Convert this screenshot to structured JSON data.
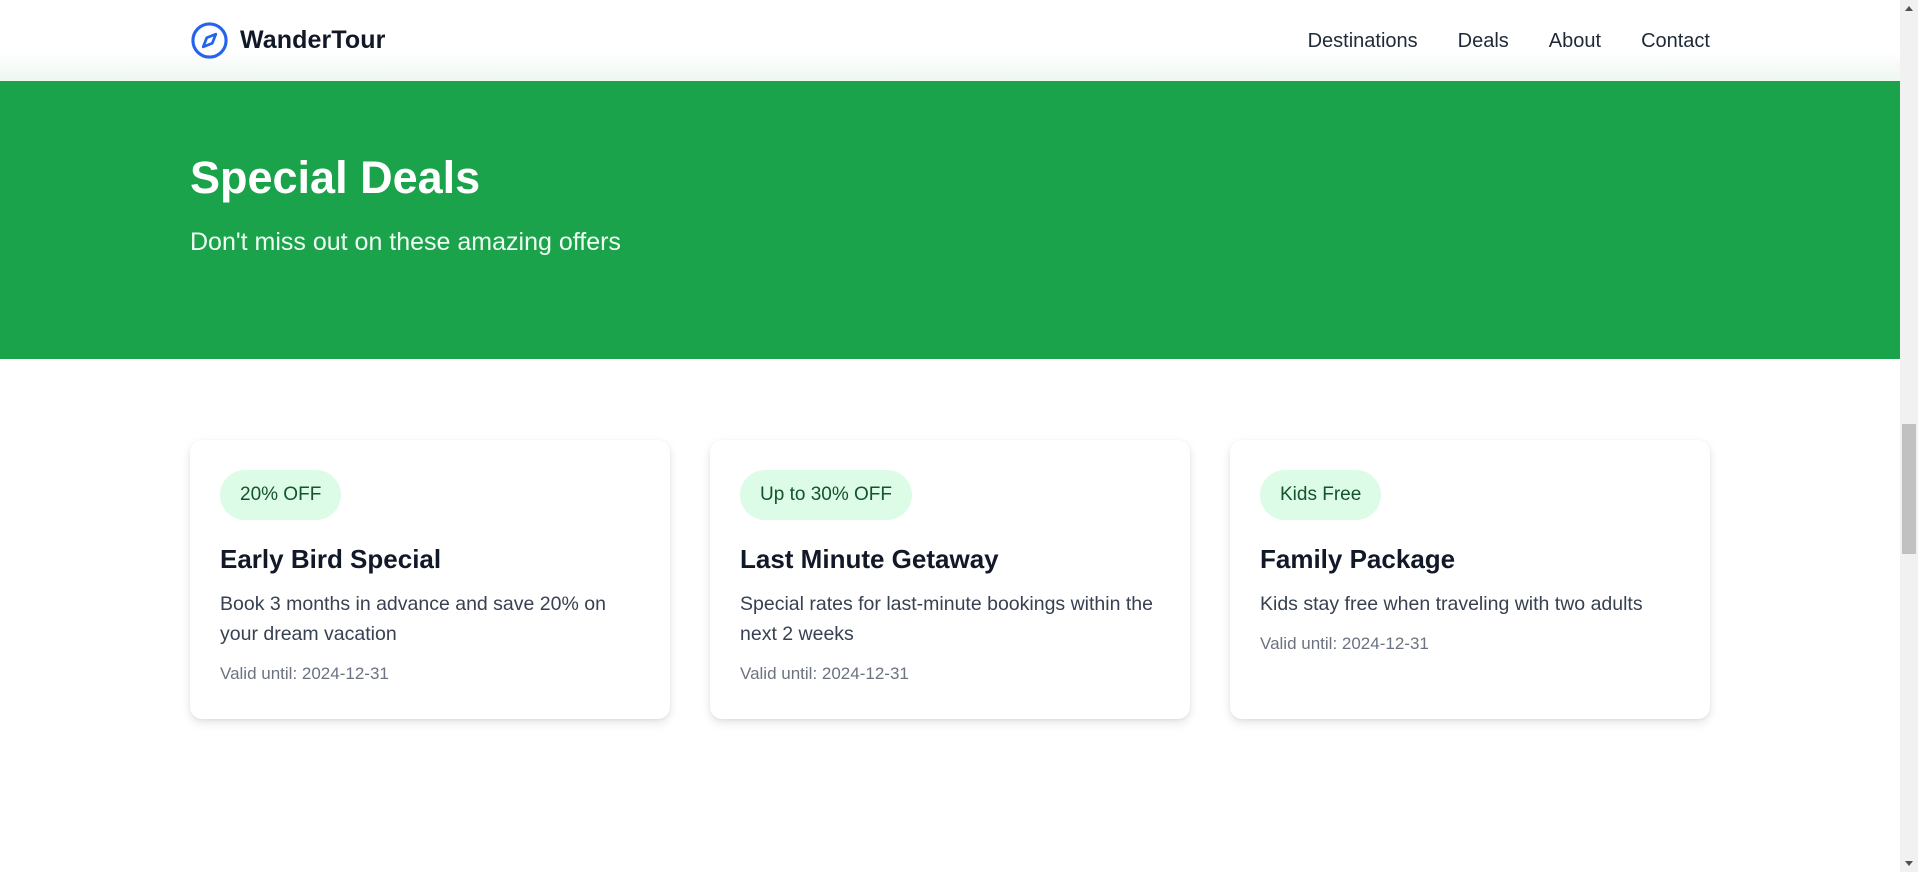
{
  "brand": {
    "name": "WanderTour",
    "icon": "compass-icon",
    "icon_color": "#2563eb"
  },
  "nav": {
    "items": [
      {
        "label": "Destinations"
      },
      {
        "label": "Deals"
      },
      {
        "label": "About"
      },
      {
        "label": "Contact"
      }
    ]
  },
  "hero": {
    "title": "Special Deals",
    "subtitle": "Don't miss out on these amazing offers",
    "background": "#1aa34a"
  },
  "deals": [
    {
      "badge": "20% OFF",
      "title": "Early Bird Special",
      "description": "Book 3 months in advance and save 20% on your dream vacation",
      "valid": "Valid until: 2024-12-31"
    },
    {
      "badge": "Up to 30% OFF",
      "title": "Last Minute Getaway",
      "description": "Special rates for last-minute bookings within the next 2 weeks",
      "valid": "Valid until: 2024-12-31"
    },
    {
      "badge": "Kids Free",
      "title": "Family Package",
      "description": "Kids stay free when traveling with two adults",
      "valid": "Valid until: 2024-12-31"
    }
  ],
  "colors": {
    "badge_bg": "#dcfce7",
    "badge_text": "#14532d"
  }
}
